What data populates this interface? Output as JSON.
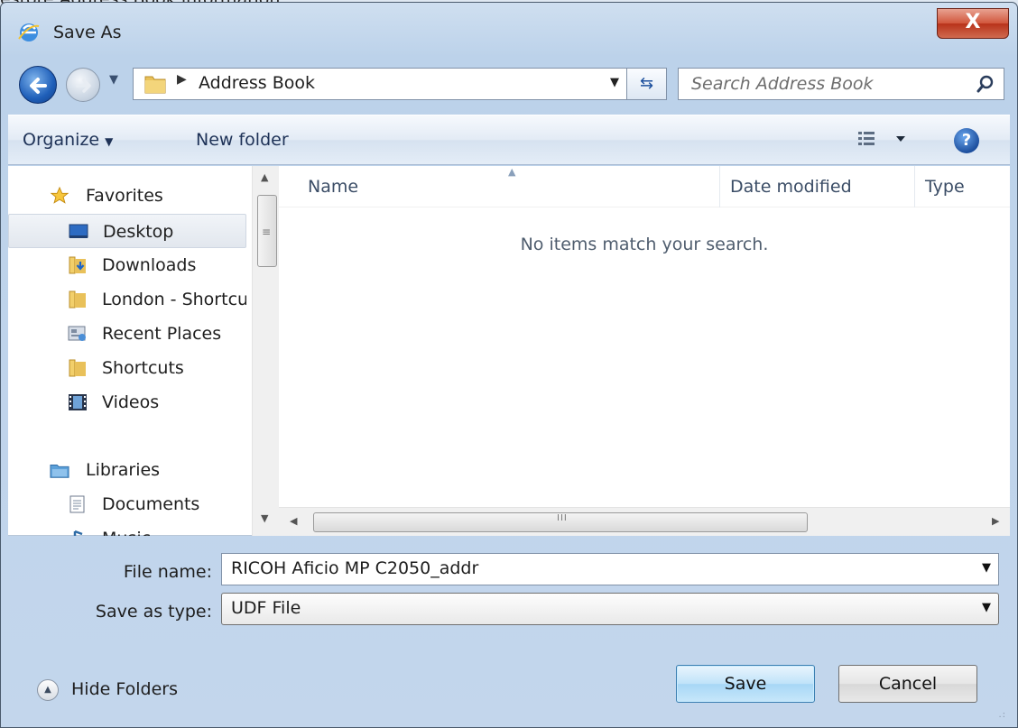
{
  "background_text": "estore Address Book information.",
  "window": {
    "title": "Save As",
    "close_glyph": "X",
    "icon": "ie-icon"
  },
  "nav": {
    "breadcrumb": "Address Book",
    "search_placeholder": "Search Address Book"
  },
  "toolbar": {
    "organize_label": "Organize",
    "new_folder_label": "New folder",
    "help_glyph": "?"
  },
  "sidebar": {
    "items": [
      {
        "label": "Favorites",
        "icon": "star-icon"
      },
      {
        "label": "Desktop",
        "icon": "desktop-icon"
      },
      {
        "label": "Downloads",
        "icon": "downloads-folder-icon"
      },
      {
        "label": "London - Shortcuts",
        "icon": "folder-icon"
      },
      {
        "label": "Recent Places",
        "icon": "recent-places-icon"
      },
      {
        "label": "Shortcuts",
        "icon": "folder-icon"
      },
      {
        "label": "Videos",
        "icon": "videos-icon"
      },
      {
        "label": "Libraries",
        "icon": "libraries-icon"
      },
      {
        "label": "Documents",
        "icon": "documents-icon"
      },
      {
        "label": "Music",
        "icon": "music-icon"
      }
    ]
  },
  "file_list": {
    "columns": [
      "Name",
      "Date modified",
      "Type"
    ],
    "empty_message": "No items match your search.",
    "scroll_grip": "III"
  },
  "form": {
    "file_name_label": "File name:",
    "file_name_value": "RICOH Aficio MP C2050_addr",
    "save_type_label": "Save as type:",
    "save_type_value": "UDF File"
  },
  "footer": {
    "hide_folders_label": "Hide Folders",
    "save_label": "Save",
    "cancel_label": "Cancel"
  }
}
